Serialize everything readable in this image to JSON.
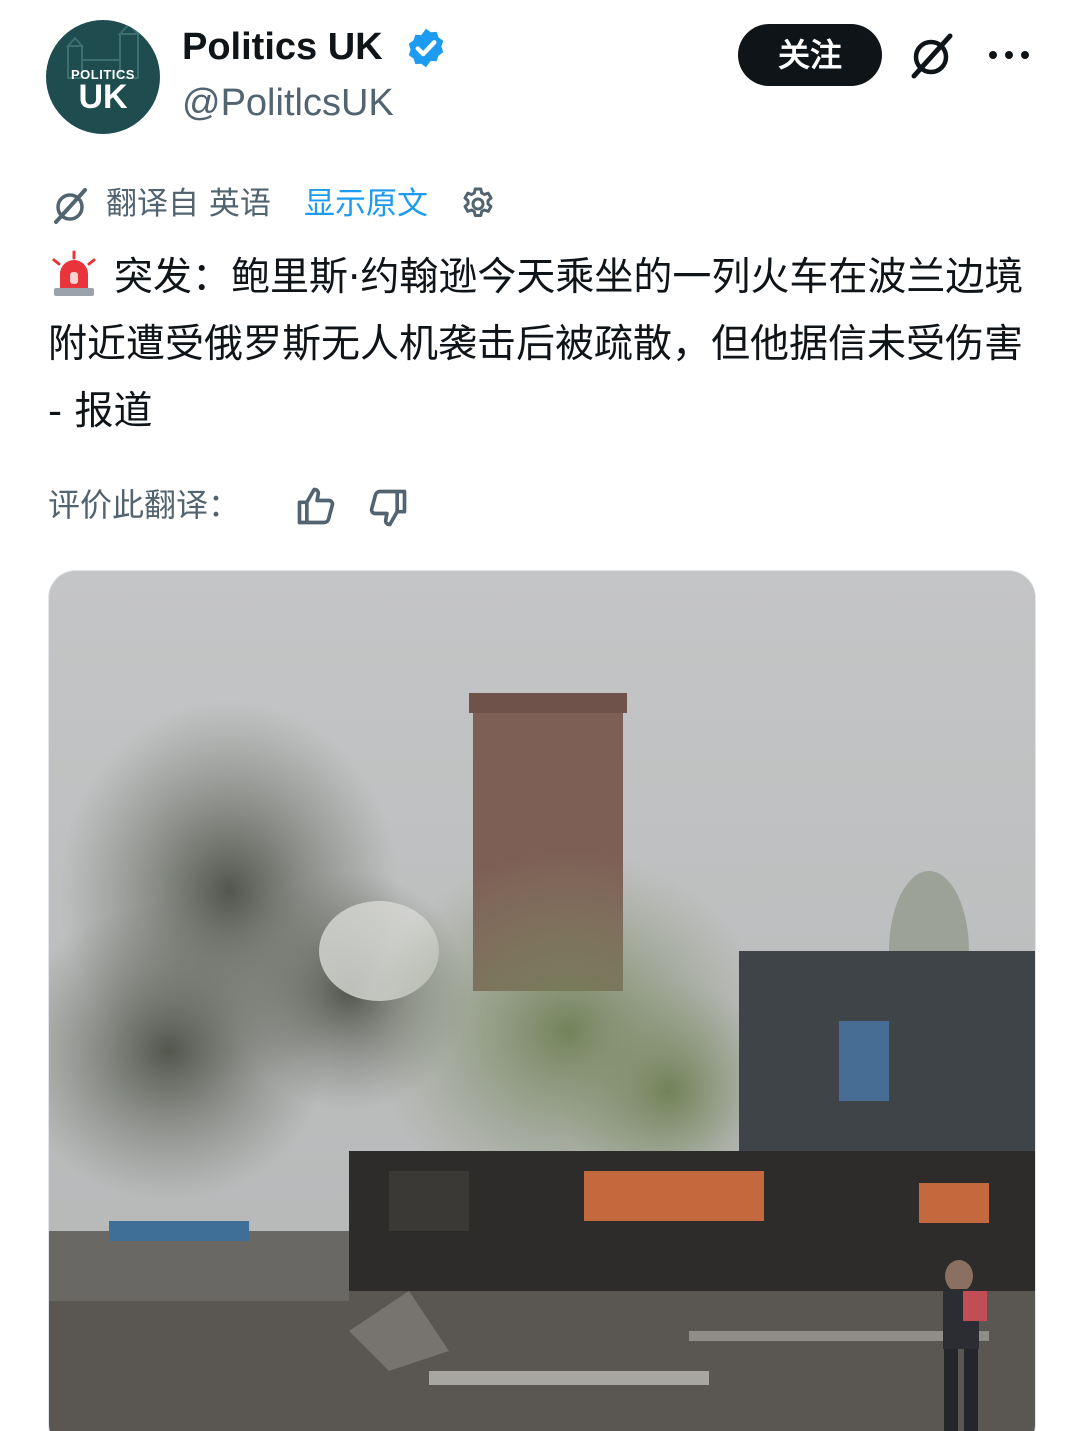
{
  "author": {
    "display_name": "Politics UK",
    "handle": "@PolitlcsUK",
    "avatar_text_small": "POLITICS",
    "avatar_text_big": "UK",
    "verified": true,
    "verified_color": "#1d9bf0"
  },
  "actions": {
    "follow_label": "关注",
    "grok_icon": "grok-icon",
    "more_icon": "more-icon"
  },
  "translation": {
    "translated_from": "翻译自 英语",
    "show_original": "显示原文",
    "settings_icon": "gear-icon"
  },
  "tweet": {
    "emoji": "siren-icon",
    "text": "突发：鲍里斯·约翰逊今天乘坐的一列火车在波兰边境附近遭受俄罗斯无人机袭击后被疏散，但他据信未受伤害 - 报道"
  },
  "rating": {
    "label": "评价此翻译：",
    "like_icon": "thumbs-up-icon",
    "dislike_icon": "thumbs-down-icon"
  },
  "colors": {
    "text": "#0f1419",
    "secondary_text": "#536471",
    "link": "#1d9bf0",
    "button_bg": "#0f1419"
  }
}
